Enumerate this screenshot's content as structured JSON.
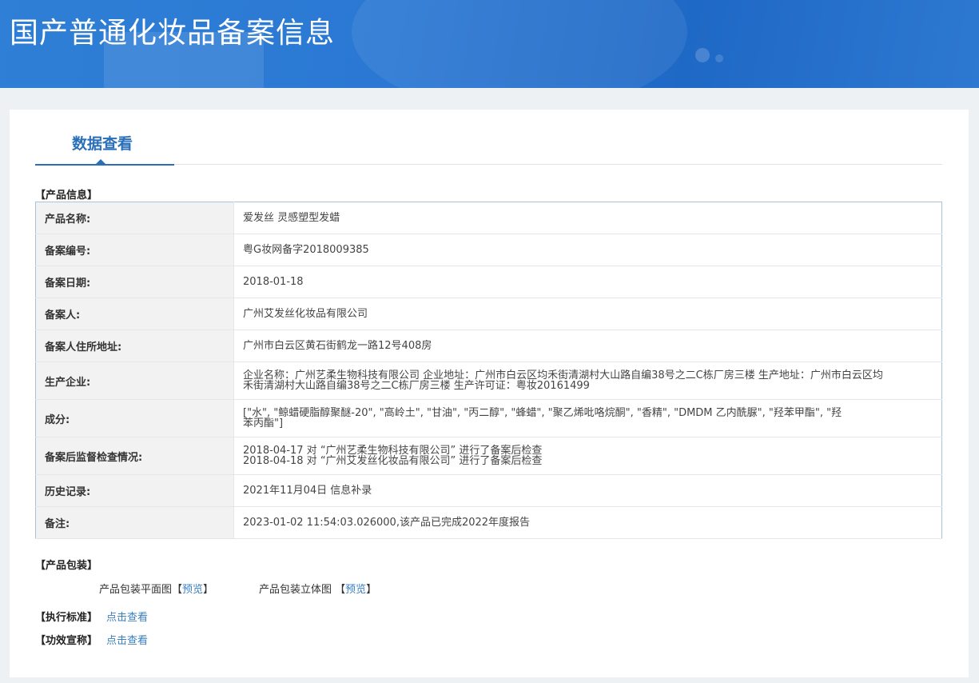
{
  "header": {
    "title": "国产普通化妆品备案信息"
  },
  "tabs": [
    {
      "label": "数据查看",
      "active": true
    }
  ],
  "product_info": {
    "section_label": "【产品信息】",
    "rows": [
      {
        "label": "产品名称:",
        "value": [
          "爱发丝 灵感塑型发蜡"
        ]
      },
      {
        "label": "备案编号:",
        "value": [
          "粤G妆网备字2018009385"
        ]
      },
      {
        "label": "备案日期:",
        "value": [
          "2018-01-18"
        ]
      },
      {
        "label": "备案人:",
        "value": [
          "广州艾发丝化妆品有限公司"
        ]
      },
      {
        "label": "备案人住所地址:",
        "value": [
          "广州市白云区黄石街鹤龙一路12号408房"
        ]
      },
      {
        "label": "生产企业:",
        "value": [
          "企业名称：广州艺柔生物科技有限公司 企业地址：广州市白云区均禾街清湖村大山路自编38号之二C栋厂房三楼 生产地址：广州市白云区均",
          "禾街清湖村大山路自编38号之二C栋厂房三楼 生产许可证：粤妆20161499"
        ]
      },
      {
        "label": "成分:",
        "value": [
          "[\"水\", \"鲸蜡硬脂醇聚醚-20\", \"高岭土\", \"甘油\", \"丙二醇\", \"蜂蜡\", \"聚乙烯吡咯烷酮\", \"香精\", \"DMDM 乙内酰脲\", \"羟苯甲酯\", \"羟",
          "苯丙酯\"]"
        ]
      },
      {
        "label": "备案后监督检查情况:",
        "value": [
          "2018-04-17 对 “广州艺柔生物科技有限公司” 进行了备案后检查",
          "2018-04-18 对 “广州艾发丝化妆品有限公司” 进行了备案后检查"
        ]
      },
      {
        "label": "历史记录:",
        "value": [
          "2021年11月04日 信息补录"
        ]
      },
      {
        "label": "备注:",
        "value": [
          "2023-01-02 11:54:03.026000,该产品已完成2022年度报告"
        ]
      }
    ]
  },
  "packaging": {
    "section_label": "【产品包装】",
    "flat_label": "产品包装平面图",
    "flat_link": "预览",
    "solid_label": "产品包装立体图",
    "solid_link": "预览"
  },
  "standard": {
    "section_label": "【执行标准】",
    "link": "点击查看"
  },
  "efficacy": {
    "section_label": "【功效宣称】",
    "link": "点击查看"
  }
}
